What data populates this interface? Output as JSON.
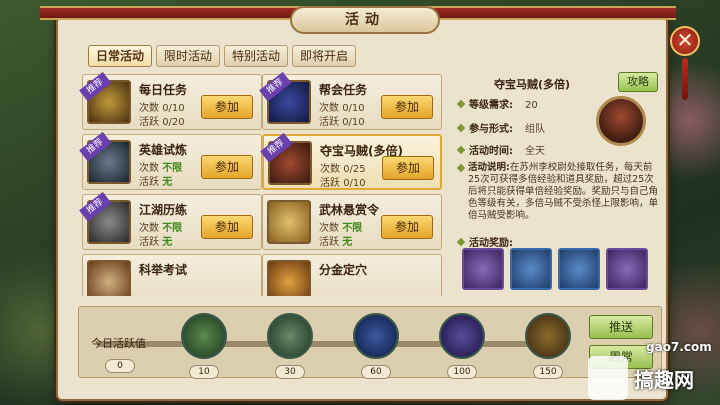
{
  "window": {
    "title": "活动"
  },
  "tabs": [
    {
      "label": "日常活动",
      "active": true
    },
    {
      "label": "限时活动",
      "active": false
    },
    {
      "label": "特别活动",
      "active": false
    },
    {
      "label": "即将开启",
      "active": false
    }
  ],
  "activities": [
    {
      "name": "每日任务",
      "badge": "推荐",
      "count_label": "次数",
      "count": "0/10",
      "active_label": "活跃",
      "active": "0/20",
      "button": "参加",
      "count_green": false,
      "active_green": false
    },
    {
      "name": "帮会任务",
      "badge": "推荐",
      "count_label": "次数",
      "count": "0/10",
      "active_label": "活跃",
      "active": "0/10",
      "button": "参加",
      "count_green": false,
      "active_green": false
    },
    {
      "name": "英雄试炼",
      "badge": "推荐",
      "count_label": "次数",
      "count": "不限",
      "active_label": "活跃",
      "active": "无",
      "button": "参加",
      "count_green": true,
      "active_green": true
    },
    {
      "name": "夺宝马贼(多倍)",
      "badge": "推荐",
      "count_label": "次数",
      "count": "0/25",
      "active_label": "活跃",
      "active": "0/10",
      "button": "参加",
      "count_green": false,
      "active_green": false,
      "selected": true
    },
    {
      "name": "江湖历练",
      "badge": "推荐",
      "count_label": "次数",
      "count": "不限",
      "active_label": "活跃",
      "active": "无",
      "button": "参加",
      "count_green": true,
      "active_green": true
    },
    {
      "name": "武林悬赏令",
      "badge": "",
      "count_label": "次数",
      "count": "不限",
      "active_label": "活跃",
      "active": "无",
      "button": "参加",
      "count_green": true,
      "active_green": true
    },
    {
      "name": "科举考试",
      "badge": "",
      "count_label": "",
      "count": "",
      "active_label": "",
      "active": "",
      "button": "",
      "partial": true
    },
    {
      "name": "分金定穴",
      "badge": "",
      "count_label": "",
      "count": "",
      "active_label": "",
      "active": "",
      "button": "",
      "partial": true
    }
  ],
  "detail": {
    "title": "夺宝马贼(多倍)",
    "guide_button": "攻略",
    "level_label": "等级需求:",
    "level_value": "20",
    "mode_label": "参与形式:",
    "mode_value": "组队",
    "time_label": "活动时间:",
    "time_value": "全天",
    "desc_label": "活动说明:",
    "desc_text": "在苏州李校尉处接取任务，每天前25次可获得多倍经验和道具奖励，超过25次后将只能获得单倍经验奖励。奖励只与自己角色等级有关，多倍马贼不受杀怪上限影响，单倍马贼受影响。",
    "reward_label": "活动奖励:"
  },
  "activity_bar": {
    "label": "今日活跃值",
    "current": "0",
    "milestones": [
      "10",
      "30",
      "60",
      "100",
      "150"
    ],
    "push_button": "推送",
    "weekly_button": "周常"
  },
  "watermark": {
    "url": "gao7.com",
    "text": "搞趣网"
  }
}
